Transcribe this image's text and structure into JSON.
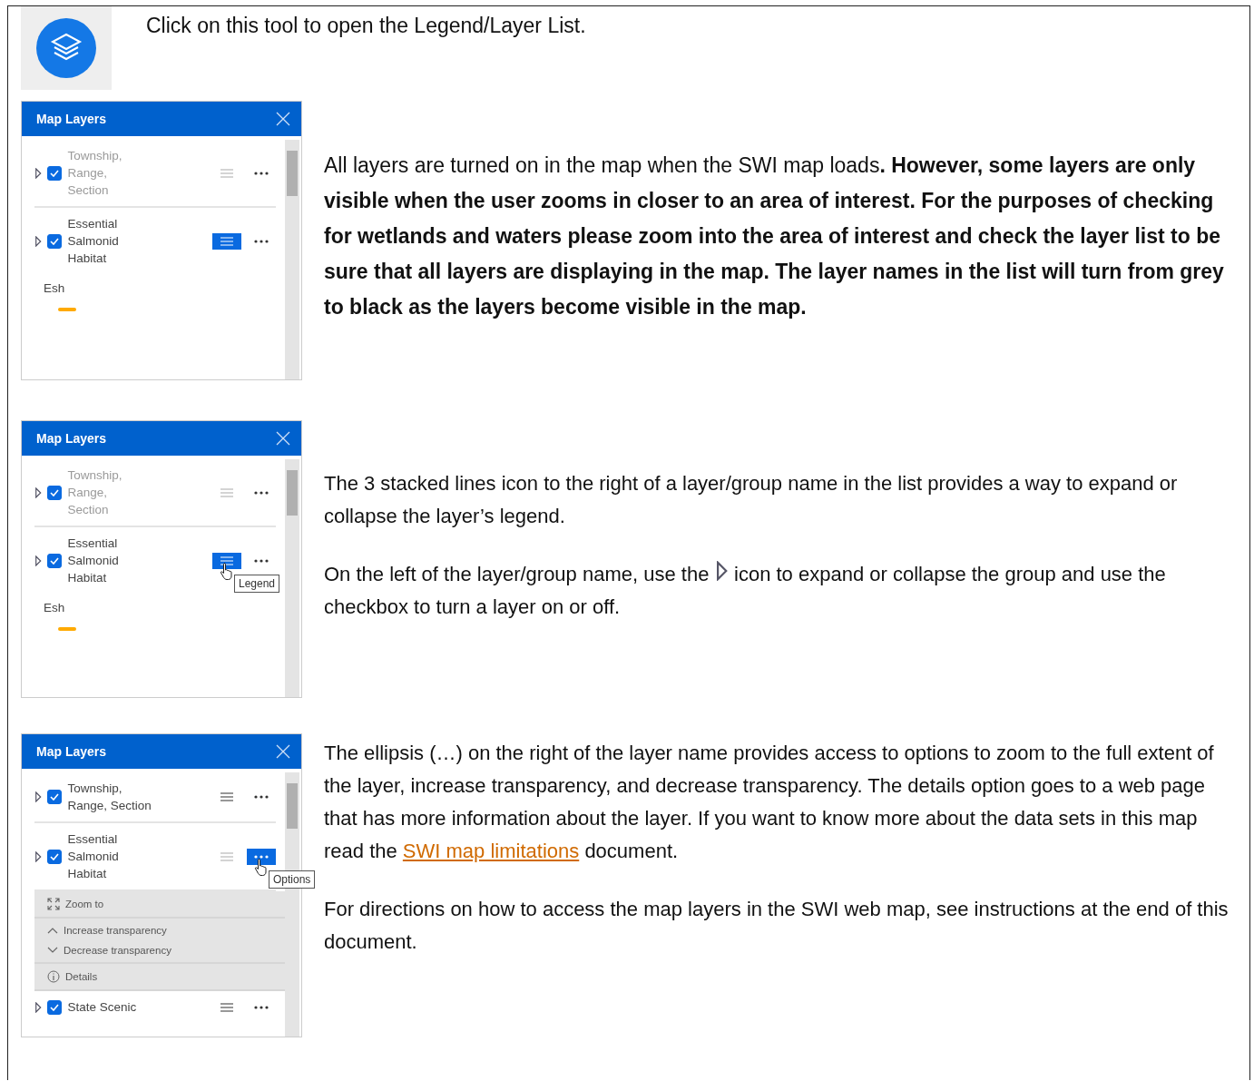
{
  "intro": {
    "text": "Click on this tool to open the Legend/Layer List."
  },
  "sections": [
    {
      "panel": {
        "title": "Map Layers",
        "layers": [
          {
            "name": "Township,\nRange,\nSection",
            "checked": true,
            "visible": false,
            "legend_selected": false,
            "options_selected": false
          },
          {
            "name": "Essential\nSalmonid\nHabitat",
            "checked": true,
            "visible": true,
            "legend_selected": true,
            "options_selected": false,
            "legend": {
              "label": "Esh",
              "color": "#ffaa00"
            }
          }
        ]
      },
      "paragraphs": [
        {
          "kind": "bold",
          "text": "All layers are turned on in the map when the SWI map loads**.  However, some layers are only visible when the user zooms in closer to an area of interest.  For the purposes of checking for wetlands and waters please zoom into the area of interest and check the layer list to be sure that all layers are displaying in the map.  The layer names in the list will turn from grey to black as the layers become visible in the map.**"
        }
      ]
    },
    {
      "panel": {
        "title": "Map Layers",
        "tooltip": "Legend",
        "layers": [
          {
            "name": "Township,\nRange,\nSection",
            "checked": true,
            "visible": false,
            "legend_selected": false,
            "options_selected": false
          },
          {
            "name": "Essential\nSalmonid\nHabitat",
            "checked": true,
            "visible": true,
            "legend_selected": true,
            "options_selected": false,
            "legend": {
              "label": "Esh",
              "color": "#ffaa00"
            }
          }
        ]
      },
      "paragraphs": [
        {
          "kind": "plain",
          "text": "The 3 stacked lines icon to the right of a layer/group name in the list provides a way to  expand or collapse the layer’s legend."
        },
        {
          "kind": "icon",
          "before": "On the left of the layer/group name, use the",
          "after": "icon to expand or collapse the group and use the checkbox to turn a layer on or off."
        }
      ]
    },
    {
      "panel": {
        "title": "Map Layers",
        "tooltip": "Options",
        "layers": [
          {
            "name": "Township,\nRange, Section",
            "checked": true,
            "visible": true,
            "legend_selected": false,
            "options_selected": false
          },
          {
            "name": "Essential\nSalmonid\nHabitat",
            "checked": true,
            "visible": true,
            "legend_selected": false,
            "options_selected": true,
            "menu": [
              [
                {
                  "kind": "zoom",
                  "label": "Zoom to"
                }
              ],
              [
                {
                  "kind": "up",
                  "label": "Increase transparency"
                },
                {
                  "kind": "down",
                  "label": "Decrease transparency"
                }
              ],
              [
                {
                  "kind": "info",
                  "label": "Details"
                }
              ]
            ]
          },
          {
            "name": "State Scenic",
            "checked": true,
            "visible": true,
            "legend_selected": false,
            "options_selected": false
          }
        ]
      },
      "paragraphs": [
        {
          "kind": "link",
          "before": "The ellipsis (…) on the right of the layer name provides access to options to zoom to the full extent of the layer, increase transparency, and decrease transparency.  The details option goes to a web page that has more information about the layer.   If you want to know more about the data sets in this map read the",
          "link": "SWI map limitations",
          "after": "document."
        },
        {
          "kind": "plain",
          "text": "For directions on how to access the map layers in the SWI web map, see instructions at the end of this document."
        }
      ]
    }
  ]
}
